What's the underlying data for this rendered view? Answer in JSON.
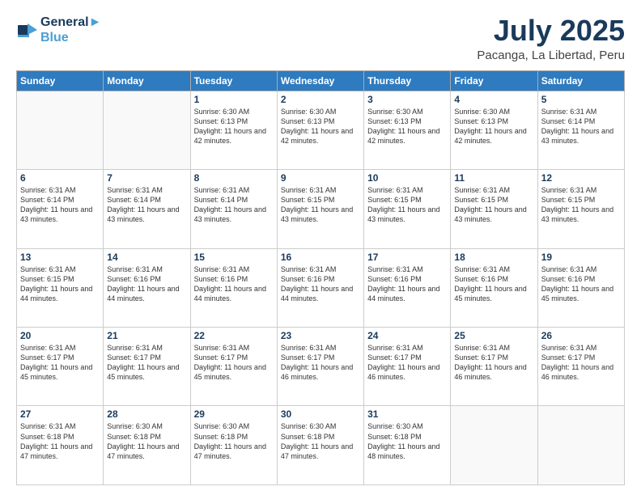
{
  "header": {
    "logo_line1": "General",
    "logo_line2": "Blue",
    "month": "July 2025",
    "location": "Pacanga, La Libertad, Peru"
  },
  "weekdays": [
    "Sunday",
    "Monday",
    "Tuesday",
    "Wednesday",
    "Thursday",
    "Friday",
    "Saturday"
  ],
  "weeks": [
    [
      {
        "day": "",
        "info": ""
      },
      {
        "day": "",
        "info": ""
      },
      {
        "day": "1",
        "info": "Sunrise: 6:30 AM\nSunset: 6:13 PM\nDaylight: 11 hours and 42 minutes."
      },
      {
        "day": "2",
        "info": "Sunrise: 6:30 AM\nSunset: 6:13 PM\nDaylight: 11 hours and 42 minutes."
      },
      {
        "day": "3",
        "info": "Sunrise: 6:30 AM\nSunset: 6:13 PM\nDaylight: 11 hours and 42 minutes."
      },
      {
        "day": "4",
        "info": "Sunrise: 6:30 AM\nSunset: 6:13 PM\nDaylight: 11 hours and 42 minutes."
      },
      {
        "day": "5",
        "info": "Sunrise: 6:31 AM\nSunset: 6:14 PM\nDaylight: 11 hours and 43 minutes."
      }
    ],
    [
      {
        "day": "6",
        "info": "Sunrise: 6:31 AM\nSunset: 6:14 PM\nDaylight: 11 hours and 43 minutes."
      },
      {
        "day": "7",
        "info": "Sunrise: 6:31 AM\nSunset: 6:14 PM\nDaylight: 11 hours and 43 minutes."
      },
      {
        "day": "8",
        "info": "Sunrise: 6:31 AM\nSunset: 6:14 PM\nDaylight: 11 hours and 43 minutes."
      },
      {
        "day": "9",
        "info": "Sunrise: 6:31 AM\nSunset: 6:15 PM\nDaylight: 11 hours and 43 minutes."
      },
      {
        "day": "10",
        "info": "Sunrise: 6:31 AM\nSunset: 6:15 PM\nDaylight: 11 hours and 43 minutes."
      },
      {
        "day": "11",
        "info": "Sunrise: 6:31 AM\nSunset: 6:15 PM\nDaylight: 11 hours and 43 minutes."
      },
      {
        "day": "12",
        "info": "Sunrise: 6:31 AM\nSunset: 6:15 PM\nDaylight: 11 hours and 43 minutes."
      }
    ],
    [
      {
        "day": "13",
        "info": "Sunrise: 6:31 AM\nSunset: 6:15 PM\nDaylight: 11 hours and 44 minutes."
      },
      {
        "day": "14",
        "info": "Sunrise: 6:31 AM\nSunset: 6:16 PM\nDaylight: 11 hours and 44 minutes."
      },
      {
        "day": "15",
        "info": "Sunrise: 6:31 AM\nSunset: 6:16 PM\nDaylight: 11 hours and 44 minutes."
      },
      {
        "day": "16",
        "info": "Sunrise: 6:31 AM\nSunset: 6:16 PM\nDaylight: 11 hours and 44 minutes."
      },
      {
        "day": "17",
        "info": "Sunrise: 6:31 AM\nSunset: 6:16 PM\nDaylight: 11 hours and 44 minutes."
      },
      {
        "day": "18",
        "info": "Sunrise: 6:31 AM\nSunset: 6:16 PM\nDaylight: 11 hours and 45 minutes."
      },
      {
        "day": "19",
        "info": "Sunrise: 6:31 AM\nSunset: 6:16 PM\nDaylight: 11 hours and 45 minutes."
      }
    ],
    [
      {
        "day": "20",
        "info": "Sunrise: 6:31 AM\nSunset: 6:17 PM\nDaylight: 11 hours and 45 minutes."
      },
      {
        "day": "21",
        "info": "Sunrise: 6:31 AM\nSunset: 6:17 PM\nDaylight: 11 hours and 45 minutes."
      },
      {
        "day": "22",
        "info": "Sunrise: 6:31 AM\nSunset: 6:17 PM\nDaylight: 11 hours and 45 minutes."
      },
      {
        "day": "23",
        "info": "Sunrise: 6:31 AM\nSunset: 6:17 PM\nDaylight: 11 hours and 46 minutes."
      },
      {
        "day": "24",
        "info": "Sunrise: 6:31 AM\nSunset: 6:17 PM\nDaylight: 11 hours and 46 minutes."
      },
      {
        "day": "25",
        "info": "Sunrise: 6:31 AM\nSunset: 6:17 PM\nDaylight: 11 hours and 46 minutes."
      },
      {
        "day": "26",
        "info": "Sunrise: 6:31 AM\nSunset: 6:17 PM\nDaylight: 11 hours and 46 minutes."
      }
    ],
    [
      {
        "day": "27",
        "info": "Sunrise: 6:31 AM\nSunset: 6:18 PM\nDaylight: 11 hours and 47 minutes."
      },
      {
        "day": "28",
        "info": "Sunrise: 6:30 AM\nSunset: 6:18 PM\nDaylight: 11 hours and 47 minutes."
      },
      {
        "day": "29",
        "info": "Sunrise: 6:30 AM\nSunset: 6:18 PM\nDaylight: 11 hours and 47 minutes."
      },
      {
        "day": "30",
        "info": "Sunrise: 6:30 AM\nSunset: 6:18 PM\nDaylight: 11 hours and 47 minutes."
      },
      {
        "day": "31",
        "info": "Sunrise: 6:30 AM\nSunset: 6:18 PM\nDaylight: 11 hours and 48 minutes."
      },
      {
        "day": "",
        "info": ""
      },
      {
        "day": "",
        "info": ""
      }
    ]
  ]
}
